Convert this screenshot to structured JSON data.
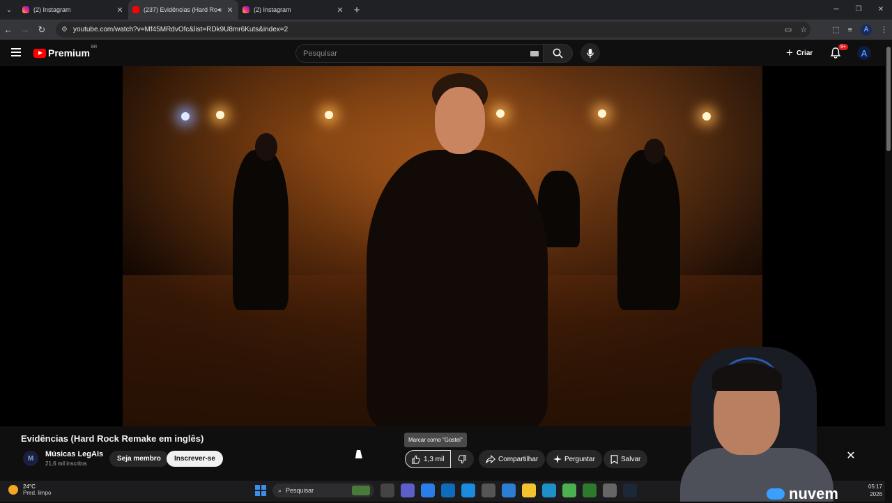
{
  "browser": {
    "tabs": [
      {
        "title": "(2) Instagram",
        "active": false
      },
      {
        "title": "(237) Evidências (Hard Rock",
        "active": true
      },
      {
        "title": "(2) Instagram",
        "active": false
      }
    ],
    "url": "youtube.com/watch?v=Mf45MRdvOfc&list=RDk9U8mr6Kuts&index=2"
  },
  "youtube": {
    "logo_text": "Premium",
    "region": "BR",
    "search_placeholder": "Pesquisar",
    "create_label": "Criar",
    "notif_badge": "9+",
    "account_initial": "A"
  },
  "video": {
    "title": "Evidências (Hard Rock Remake em inglês)",
    "channel": "Músicas LegAIs",
    "channel_avatar": "M",
    "subscribers": "21,6 mil inscritos",
    "member_label": "Seja membro",
    "subscribe_label": "Inscrever-se",
    "like_count": "1,3 mil",
    "like_tooltip": "Marcar como \"Gostei\"",
    "share_label": "Compartilhar",
    "ask_label": "Perguntar",
    "save_label": "Salvar"
  },
  "overlay": {
    "brand": "nuvem"
  },
  "taskbar": {
    "temp": "24°C",
    "weather": "Pred. limpo",
    "search_placeholder": "Pesquisar",
    "time": "05:17",
    "date": "2026"
  },
  "colors": {
    "youtube_red": "#ff0000",
    "accent_blue": "#3b8eea"
  }
}
